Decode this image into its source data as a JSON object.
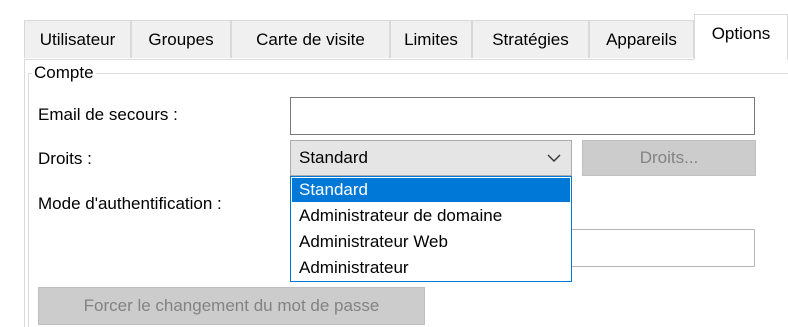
{
  "tabs": [
    {
      "label": "Utilisateur"
    },
    {
      "label": "Groupes"
    },
    {
      "label": "Carte de visite"
    },
    {
      "label": "Limites"
    },
    {
      "label": "Stratégies"
    },
    {
      "label": "Appareils"
    },
    {
      "label": "Options",
      "active": true
    }
  ],
  "group": {
    "title": "Compte"
  },
  "fields": {
    "backup_email": {
      "label": "Email de secours :",
      "value": ""
    },
    "rights": {
      "label": "Droits :",
      "selected": "Standard",
      "button_label": "Droits..."
    },
    "auth_mode": {
      "label": "Mode d'authentification :",
      "value": ""
    }
  },
  "dropdown": {
    "options": [
      "Standard",
      "Administrateur de domaine",
      "Administrateur Web",
      "Administrateur"
    ],
    "highlighted": "Standard"
  },
  "force_password_button": {
    "label": "Forcer le changement du mot de passe"
  },
  "colors": {
    "highlight": "#0078d7",
    "disabled_button_bg": "#cccccc",
    "disabled_text": "#838383",
    "combo_bg": "#e5e5e5"
  },
  "icons": {
    "combo_chevron": "chevron-down-icon"
  }
}
